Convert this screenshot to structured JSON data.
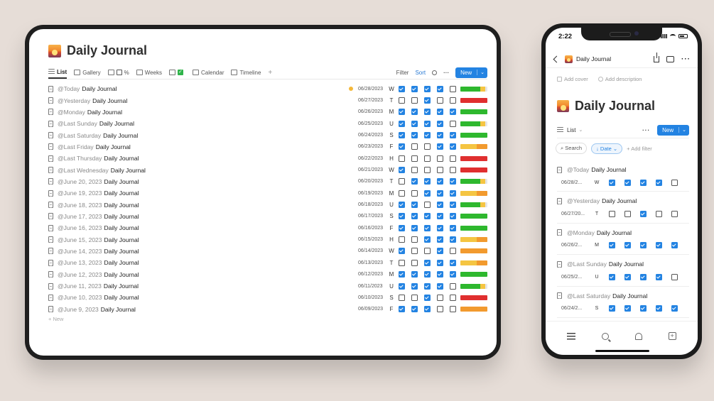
{
  "tablet": {
    "title": "Daily Journal",
    "views": [
      {
        "label": "List",
        "icon": "list-icon",
        "active": true
      },
      {
        "label": "Gallery",
        "icon": "gallery-icon"
      },
      {
        "label": "%",
        "icon": "table-icon"
      },
      {
        "label": "Weeks",
        "icon": "board-icon"
      },
      {
        "label": "",
        "icon": "checkbox-list-icon"
      },
      {
        "label": "Calendar",
        "icon": "calendar-icon"
      },
      {
        "label": "Timeline",
        "icon": "timeline-icon"
      }
    ],
    "add_view": "+",
    "filter": "Filter",
    "sort": "Sort",
    "more": "···",
    "new": "New",
    "new_row": "+ New",
    "rows": [
      {
        "mention": "@Today",
        "name": "Daily Journal",
        "date": "06/28/2023",
        "day": "W",
        "checks": [
          1,
          1,
          1,
          1,
          0
        ],
        "bar": [
          {
            "c": "#2eb82e",
            "w": 74
          },
          {
            "c": "#f5c542",
            "w": 18
          }
        ],
        "dot": true
      },
      {
        "mention": "@Yesterday",
        "name": "Daily Journal",
        "date": "06/27/2023",
        "day": "T",
        "checks": [
          0,
          0,
          1,
          0,
          0
        ],
        "bar": [
          {
            "c": "#e02f2f",
            "w": 100
          }
        ]
      },
      {
        "mention": "@Monday",
        "name": "Daily Journal",
        "date": "06/26/2023",
        "day": "M",
        "checks": [
          1,
          1,
          1,
          1,
          1
        ],
        "bar": [
          {
            "c": "#2eb82e",
            "w": 100
          }
        ]
      },
      {
        "mention": "@Last Sunday",
        "name": "Daily Journal",
        "date": "06/25/2023",
        "day": "U",
        "checks": [
          1,
          1,
          1,
          1,
          0
        ],
        "bar": [
          {
            "c": "#2eb82e",
            "w": 74
          },
          {
            "c": "#f5c542",
            "w": 18
          }
        ]
      },
      {
        "mention": "@Last Saturday",
        "name": "Daily Journal",
        "date": "06/24/2023",
        "day": "S",
        "checks": [
          1,
          1,
          1,
          1,
          1
        ],
        "bar": [
          {
            "c": "#2eb82e",
            "w": 100
          }
        ]
      },
      {
        "mention": "@Last Friday",
        "name": "Daily Journal",
        "date": "06/23/2023",
        "day": "F",
        "checks": [
          1,
          0,
          0,
          1,
          1
        ],
        "bar": [
          {
            "c": "#f5c542",
            "w": 60
          },
          {
            "c": "#f29a2e",
            "w": 40
          }
        ]
      },
      {
        "mention": "@Last Thursday",
        "name": "Daily Journal",
        "date": "06/22/2023",
        "day": "H",
        "checks": [
          0,
          0,
          0,
          0,
          0
        ],
        "bar": [
          {
            "c": "#e02f2f",
            "w": 100
          }
        ]
      },
      {
        "mention": "@Last Wednesday",
        "name": "Daily Journal",
        "date": "06/21/2023",
        "day": "W",
        "checks": [
          1,
          0,
          0,
          0,
          0
        ],
        "bar": [
          {
            "c": "#e02f2f",
            "w": 100
          }
        ]
      },
      {
        "mention": "@June 20, 2023",
        "name": "Daily Journal",
        "date": "06/20/2023",
        "day": "T",
        "checks": [
          0,
          1,
          1,
          1,
          1
        ],
        "bar": [
          {
            "c": "#2eb82e",
            "w": 74
          },
          {
            "c": "#f5c542",
            "w": 18
          }
        ]
      },
      {
        "mention": "@June 19, 2023",
        "name": "Daily Journal",
        "date": "06/19/2023",
        "day": "M",
        "checks": [
          0,
          0,
          1,
          1,
          1
        ],
        "bar": [
          {
            "c": "#f5c542",
            "w": 60
          },
          {
            "c": "#f29a2e",
            "w": 40
          }
        ]
      },
      {
        "mention": "@June 18, 2023",
        "name": "Daily Journal",
        "date": "06/18/2023",
        "day": "U",
        "checks": [
          1,
          1,
          0,
          1,
          1
        ],
        "bar": [
          {
            "c": "#2eb82e",
            "w": 74
          },
          {
            "c": "#f5c542",
            "w": 18
          }
        ]
      },
      {
        "mention": "@June 17, 2023",
        "name": "Daily Journal",
        "date": "06/17/2023",
        "day": "S",
        "checks": [
          1,
          1,
          1,
          1,
          1
        ],
        "bar": [
          {
            "c": "#2eb82e",
            "w": 100
          }
        ]
      },
      {
        "mention": "@June 16, 2023",
        "name": "Daily Journal",
        "date": "06/16/2023",
        "day": "F",
        "checks": [
          1,
          1,
          1,
          1,
          1
        ],
        "bar": [
          {
            "c": "#2eb82e",
            "w": 100
          }
        ]
      },
      {
        "mention": "@June 15, 2023",
        "name": "Daily Journal",
        "date": "06/15/2023",
        "day": "H",
        "checks": [
          0,
          0,
          1,
          1,
          1
        ],
        "bar": [
          {
            "c": "#f5c542",
            "w": 60
          },
          {
            "c": "#f29a2e",
            "w": 40
          }
        ]
      },
      {
        "mention": "@June 14, 2023",
        "name": "Daily Journal",
        "date": "06/14/2023",
        "day": "W",
        "checks": [
          1,
          0,
          0,
          1,
          0
        ],
        "bar": [
          {
            "c": "#f29a2e",
            "w": 100
          }
        ]
      },
      {
        "mention": "@June 13, 2023",
        "name": "Daily Journal",
        "date": "06/13/2023",
        "day": "T",
        "checks": [
          0,
          0,
          1,
          1,
          1
        ],
        "bar": [
          {
            "c": "#f5c542",
            "w": 60
          },
          {
            "c": "#f29a2e",
            "w": 40
          }
        ]
      },
      {
        "mention": "@June 12, 2023",
        "name": "Daily Journal",
        "date": "06/12/2023",
        "day": "M",
        "checks": [
          1,
          1,
          1,
          1,
          1
        ],
        "bar": [
          {
            "c": "#2eb82e",
            "w": 100
          }
        ]
      },
      {
        "mention": "@June 11, 2023",
        "name": "Daily Journal",
        "date": "06/11/2023",
        "day": "U",
        "checks": [
          1,
          1,
          1,
          1,
          0
        ],
        "bar": [
          {
            "c": "#2eb82e",
            "w": 74
          },
          {
            "c": "#f5c542",
            "w": 18
          }
        ]
      },
      {
        "mention": "@June 10, 2023",
        "name": "Daily Journal",
        "date": "06/10/2023",
        "day": "S",
        "checks": [
          0,
          0,
          1,
          0,
          0
        ],
        "bar": [
          {
            "c": "#e02f2f",
            "w": 100
          }
        ]
      },
      {
        "mention": "@June 9, 2023",
        "name": "Daily Journal",
        "date": "06/09/2023",
        "day": "F",
        "checks": [
          1,
          1,
          1,
          0,
          0
        ],
        "bar": [
          {
            "c": "#f29a2e",
            "w": 100
          }
        ]
      }
    ]
  },
  "phone": {
    "time": "2:22",
    "nav_title": "Daily Journal",
    "add_cover": "Add cover",
    "add_description": "Add description",
    "title": "Daily Journal",
    "view": "List",
    "more": "···",
    "new": "New",
    "search": "Search",
    "date_filter": "Date",
    "add_filter": "Add filter",
    "cards": [
      {
        "mention": "@Today",
        "name": "Daily Journal",
        "date": "06/28/2...",
        "day": "W",
        "checks": [
          1,
          1,
          1,
          1,
          0
        ]
      },
      {
        "mention": "@Yesterday",
        "name": "Daily Journal",
        "date": "06/27/20...",
        "day": "T",
        "checks": [
          0,
          0,
          1,
          0,
          0
        ]
      },
      {
        "mention": "@Monday",
        "name": "Daily Journal",
        "date": "06/26/2...",
        "day": "M",
        "checks": [
          1,
          1,
          1,
          1,
          1
        ]
      },
      {
        "mention": "@Last Sunday",
        "name": "Daily Journal",
        "date": "06/25/2...",
        "day": "U",
        "checks": [
          1,
          1,
          1,
          1,
          0
        ]
      },
      {
        "mention": "@Last Saturday",
        "name": "Daily Journal",
        "date": "06/24/2...",
        "day": "S",
        "checks": [
          1,
          1,
          1,
          1,
          1
        ]
      }
    ]
  }
}
